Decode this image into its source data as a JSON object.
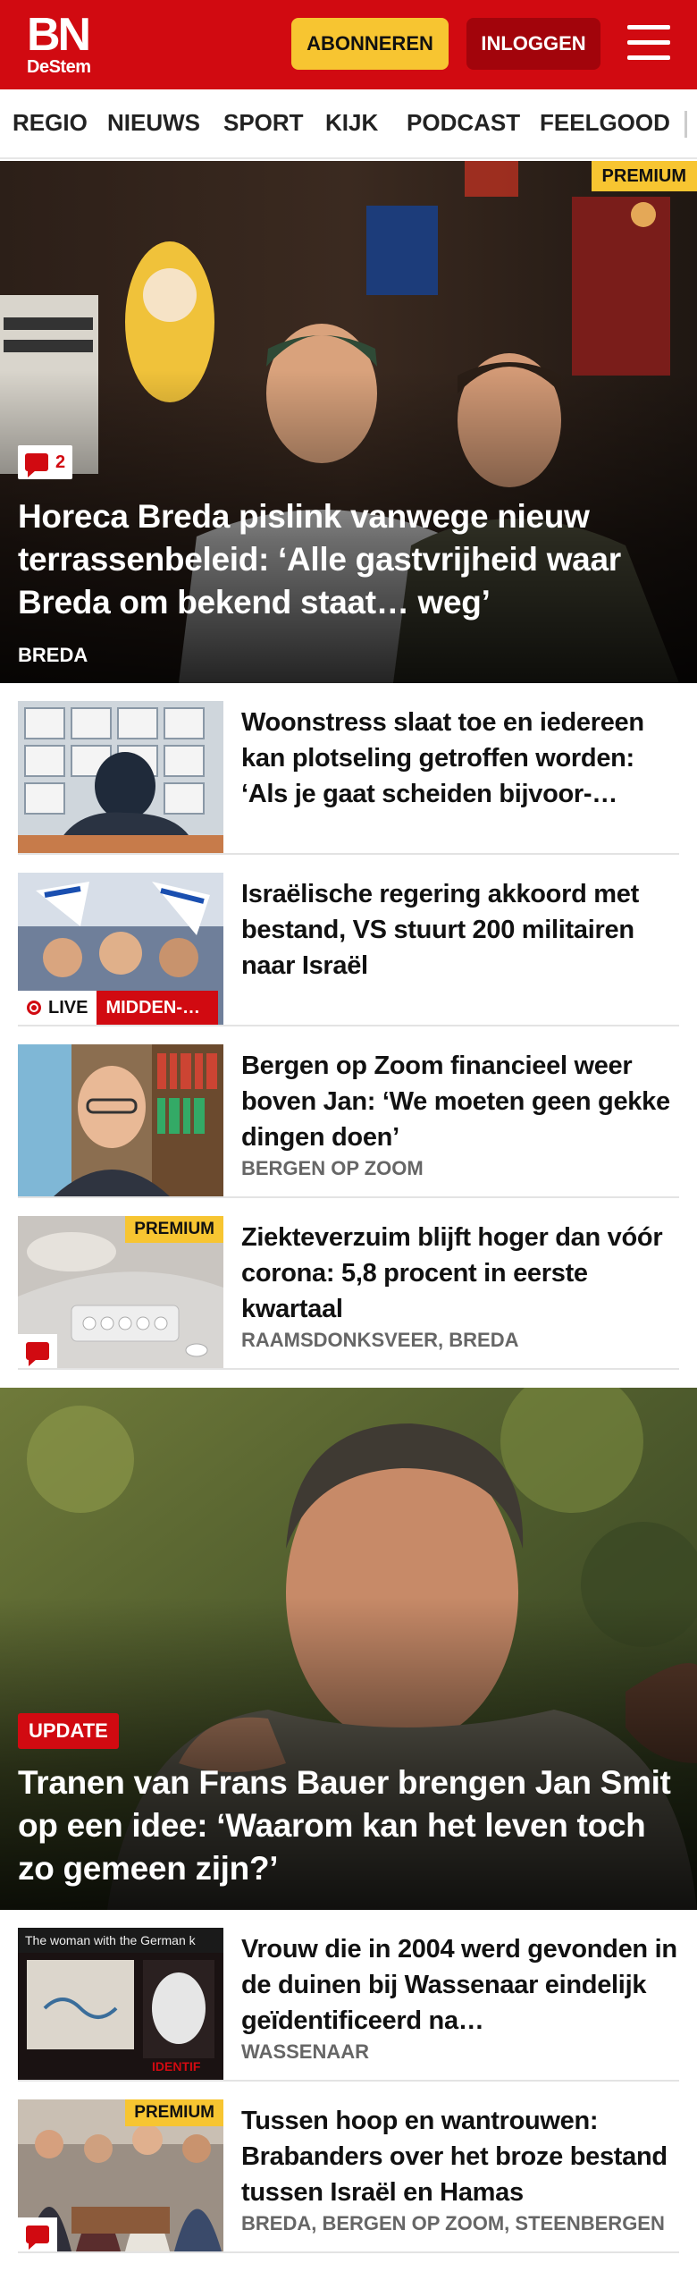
{
  "header": {
    "logo_main": "BN",
    "logo_sub": "DeStem",
    "subscribe_label": "ABONNEREN",
    "login_label": "INLOGGEN",
    "menu_icon": "hamburger-menu-icon",
    "brand_color": "#d10a11",
    "accent_color": "#f7c531"
  },
  "nav": {
    "items": [
      {
        "label": "REGIO"
      },
      {
        "label": "NIEUWS"
      },
      {
        "label": "SPORT"
      },
      {
        "label": "KIJK"
      },
      {
        "label": "PODCAST"
      },
      {
        "label": "FEELGOOD"
      }
    ]
  },
  "hero1": {
    "badge": "PREMIUM",
    "comment_count": "2",
    "title": "Horeca Breda pislink vanwege nieuw terrassenbeleid: ‘Alle gastvrijheid waar Breda om bekend staat… weg’",
    "tag": "BREDA"
  },
  "list1": [
    {
      "title": "Woonstress slaat toe en iedereen kan plotseling getroffen worden: ‘Als je gaat scheiden bijvoor-…",
      "tag": ""
    },
    {
      "title": "Israëlische regering akkoord met bestand, VS stuurt 200 militairen naar Israël",
      "live_label": "LIVE",
      "live_category": "MIDDEN-OOSTEN",
      "tag": ""
    },
    {
      "title": "Bergen op Zoom financieel weer boven Jan: ‘We moeten geen gekke dingen doen’",
      "tag": "BERGEN OP ZOOM"
    },
    {
      "title": "Ziekteverzuim blijft hoger dan vóór corona: 5,8 procent in eerste kwartaal",
      "premium": "PREMIUM",
      "tag": "RAAMSDONKSVEER, BREDA"
    }
  ],
  "hero2": {
    "badge": "UPDATE",
    "title": "Tranen van Frans Bauer brengen Jan Smit op een idee: ‘Waarom kan het leven toch zo gemeen zijn?’"
  },
  "list2": [
    {
      "title": "Vrouw die in 2004 werd gevonden in de duinen bij Wassenaar eindelijk geïdentificeerd na…",
      "thumb_caption": "The woman with the German k",
      "thumb_caption2": "IDENTIF",
      "tag": "WASSENAAR"
    },
    {
      "title": "Tussen hoop en wantrouwen: Brabanders over het broze bestand tussen Israël en Hamas",
      "premium": "PREMIUM",
      "tag": "BREDA, BERGEN OP ZOOM, STEENBERGEN"
    }
  ]
}
